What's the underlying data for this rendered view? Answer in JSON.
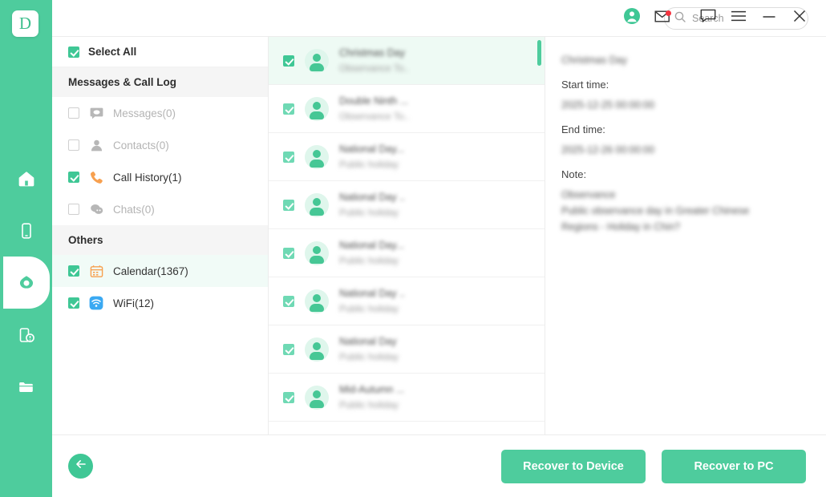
{
  "app": {
    "logo_letter": "D",
    "accent_color": "#4ecc9d",
    "accent_dark": "#3fc795",
    "badge_color": "#f5333f"
  },
  "rail": {
    "items": [
      {
        "name": "home-icon",
        "label": "Home"
      },
      {
        "name": "device-icon",
        "label": "Device"
      },
      {
        "name": "recover-icon",
        "label": "Recover"
      },
      {
        "name": "repair-icon",
        "label": "Repair"
      },
      {
        "name": "files-icon",
        "label": "Files"
      }
    ]
  },
  "titlebar": {
    "icons": [
      {
        "name": "account-icon",
        "label": "Account"
      },
      {
        "name": "mail-icon",
        "label": "Messages",
        "badge": true
      },
      {
        "name": "feedback-icon",
        "label": "Feedback"
      },
      {
        "name": "menu-icon",
        "label": "Menu"
      },
      {
        "name": "minimize-icon",
        "label": "Minimize"
      },
      {
        "name": "close-icon",
        "label": "Close"
      }
    ]
  },
  "categories": {
    "select_all_label": "Select All",
    "select_all_checked": true,
    "groups": [
      {
        "title": "Messages & Call Log",
        "items": [
          {
            "label": "Messages(0)",
            "checked": false,
            "disabled": true,
            "icon": "messages-icon"
          },
          {
            "label": "Contacts(0)",
            "checked": false,
            "disabled": true,
            "icon": "contacts-icon"
          },
          {
            "label": "Call History(1)",
            "checked": true,
            "disabled": false,
            "icon": "call-history-icon"
          },
          {
            "label": "Chats(0)",
            "checked": false,
            "disabled": true,
            "icon": "chats-icon"
          }
        ]
      },
      {
        "title": "Others",
        "items": [
          {
            "label": "Calendar(1367)",
            "checked": true,
            "disabled": false,
            "icon": "calendar-icon",
            "selected": true
          },
          {
            "label": "WiFi(12)",
            "checked": true,
            "disabled": false,
            "icon": "wifi-icon"
          }
        ]
      }
    ]
  },
  "search": {
    "placeholder": "Search",
    "value": "",
    "icon": "search-icon"
  },
  "list": {
    "rows": [
      {
        "title": "Christmas Day",
        "subtitle": "Observance To..",
        "checked": true,
        "active": true
      },
      {
        "title": "Double Ninth ...",
        "subtitle": "Observance To..",
        "checked": true,
        "active": false
      },
      {
        "title": "National Day...",
        "subtitle": "Public holiday",
        "checked": true,
        "active": false
      },
      {
        "title": "National Day ..",
        "subtitle": "Public holiday",
        "checked": true,
        "active": false
      },
      {
        "title": "National Day...",
        "subtitle": "Public holiday",
        "checked": true,
        "active": false
      },
      {
        "title": "National Day ..",
        "subtitle": "Public holiday",
        "checked": true,
        "active": false
      },
      {
        "title": "National Day",
        "subtitle": "Public holiday",
        "checked": true,
        "active": false
      },
      {
        "title": "Mid-Autumn ...",
        "subtitle": "Public holiday",
        "checked": true,
        "active": false
      }
    ]
  },
  "detail": {
    "title": "Christmas Day",
    "start_time_label": "Start time:",
    "start_time_value": "2025-12-25 00:00:00",
    "end_time_label": "End time:",
    "end_time_value": "2025-12-26 00:00:00",
    "note_label": "Note:",
    "note_lines": [
      "Observance",
      "Public observance day in Greater Chinese",
      "Regions - Holiday in Chin?"
    ]
  },
  "footer": {
    "back_icon": "back-arrow-icon",
    "recover_to_device_label": "Recover to Device",
    "recover_to_pc_label": "Recover to PC"
  }
}
